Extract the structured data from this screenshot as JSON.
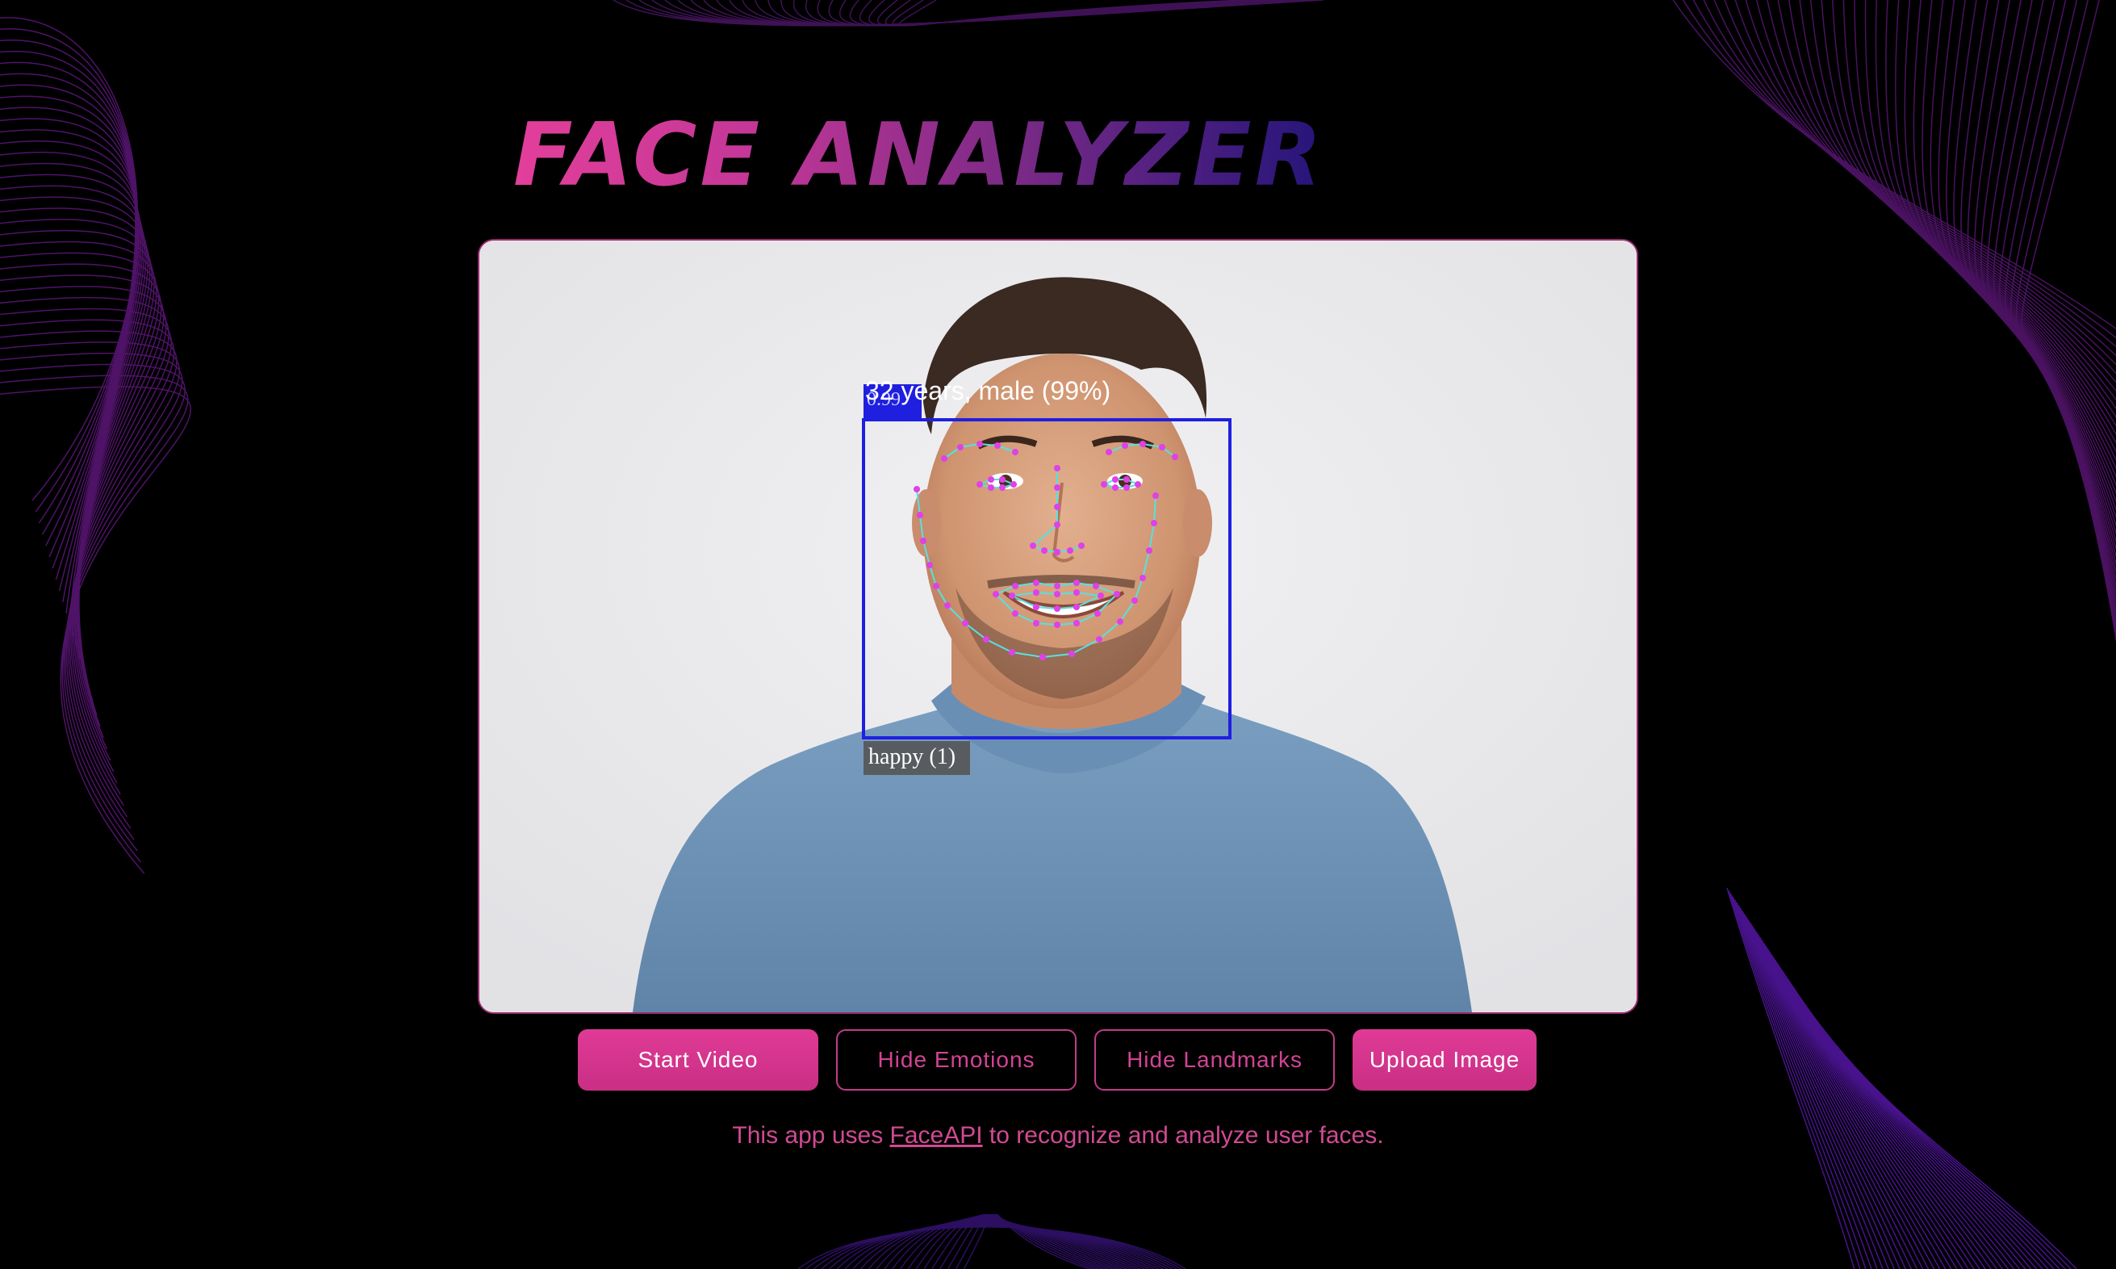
{
  "app": {
    "title": "FACE ANALYZER"
  },
  "detection": {
    "age_gender_label": "32 years, male (99%)",
    "score_label": "0.99",
    "emotion_label": "happy (1)"
  },
  "buttons": {
    "start_video": "Start Video",
    "hide_emotions": "Hide Emotions",
    "hide_landmarks": "Hide Landmarks",
    "upload_image": "Upload Image"
  },
  "footer": {
    "text_before": "This app uses ",
    "link_text": "FaceAPI",
    "text_after": " to recognize and analyze user faces."
  },
  "colors": {
    "accent": "#e03a96",
    "detection_box": "#1f1fe0",
    "landmark_point": "#e040e8",
    "landmark_line": "#58e0e0"
  }
}
